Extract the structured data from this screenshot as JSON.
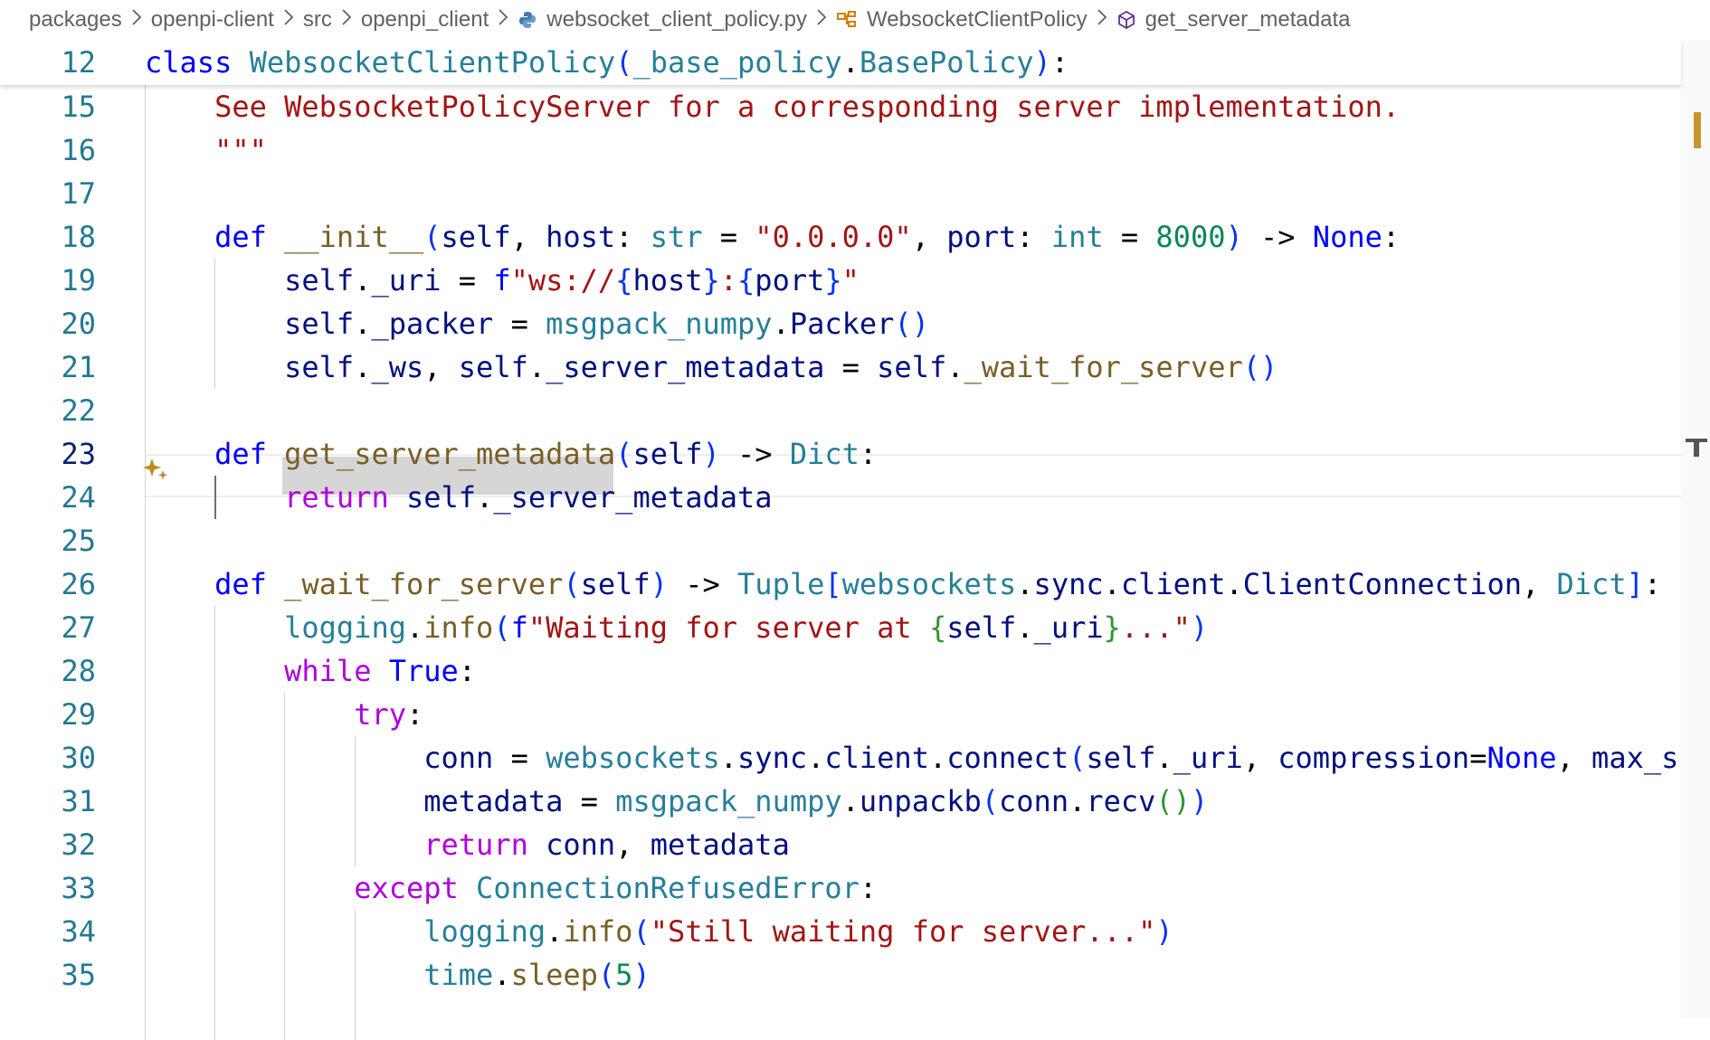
{
  "breadcrumb": [
    {
      "label": "packages",
      "icon": ""
    },
    {
      "label": "openpi-client",
      "icon": ""
    },
    {
      "label": "src",
      "icon": ""
    },
    {
      "label": "openpi_client",
      "icon": ""
    },
    {
      "label": "websocket_client_policy.py",
      "icon": "python-file-icon"
    },
    {
      "label": "WebsocketClientPolicy",
      "icon": "class-symbol-icon"
    },
    {
      "label": "get_server_metadata",
      "icon": "method-symbol-icon"
    }
  ],
  "sticky": {
    "line_number": "12",
    "tokens": [
      {
        "t": "class",
        "c": "kw"
      },
      {
        "t": " ",
        "c": "pl"
      },
      {
        "t": "WebsocketClientPolicy",
        "c": "typ"
      },
      {
        "t": "(",
        "c": "br"
      },
      {
        "t": "_base_policy",
        "c": "typ"
      },
      {
        "t": ".",
        "c": "pl"
      },
      {
        "t": "BasePolicy",
        "c": "typ"
      },
      {
        "t": ")",
        "c": "br"
      },
      {
        "t": ":",
        "c": "pl"
      }
    ]
  },
  "editor": {
    "current_line": "23",
    "highlighted_word": "get_server_metadata",
    "lines": [
      {
        "n": "15",
        "tokens": [
          {
            "t": "    See WebsocketPolicyServer for a corresponding server implementation.",
            "c": "str"
          }
        ]
      },
      {
        "n": "16",
        "tokens": [
          {
            "t": "    \"\"\"",
            "c": "str"
          }
        ]
      },
      {
        "n": "17",
        "tokens": []
      },
      {
        "n": "18",
        "tokens": [
          {
            "t": "    ",
            "c": "pl"
          },
          {
            "t": "def",
            "c": "kw"
          },
          {
            "t": " ",
            "c": "pl"
          },
          {
            "t": "__init__",
            "c": "fn"
          },
          {
            "t": "(",
            "c": "br"
          },
          {
            "t": "self",
            "c": "var"
          },
          {
            "t": ", ",
            "c": "pl"
          },
          {
            "t": "host",
            "c": "var"
          },
          {
            "t": ": ",
            "c": "pl"
          },
          {
            "t": "str",
            "c": "typ"
          },
          {
            "t": " = ",
            "c": "pl"
          },
          {
            "t": "\"0.0.0.0\"",
            "c": "str"
          },
          {
            "t": ", ",
            "c": "pl"
          },
          {
            "t": "port",
            "c": "var"
          },
          {
            "t": ": ",
            "c": "pl"
          },
          {
            "t": "int",
            "c": "typ"
          },
          {
            "t": " = ",
            "c": "pl"
          },
          {
            "t": "8000",
            "c": "num"
          },
          {
            "t": ")",
            "c": "br"
          },
          {
            "t": " -> ",
            "c": "pl"
          },
          {
            "t": "None",
            "c": "kw"
          },
          {
            "t": ":",
            "c": "pl"
          }
        ]
      },
      {
        "n": "19",
        "tokens": [
          {
            "t": "        ",
            "c": "pl"
          },
          {
            "t": "self",
            "c": "var"
          },
          {
            "t": ".",
            "c": "pl"
          },
          {
            "t": "_uri",
            "c": "var"
          },
          {
            "t": " = ",
            "c": "pl"
          },
          {
            "t": "f",
            "c": "kw"
          },
          {
            "t": "\"ws://",
            "c": "str"
          },
          {
            "t": "{",
            "c": "br"
          },
          {
            "t": "host",
            "c": "var"
          },
          {
            "t": "}",
            "c": "br"
          },
          {
            "t": ":",
            "c": "str"
          },
          {
            "t": "{",
            "c": "br"
          },
          {
            "t": "port",
            "c": "var"
          },
          {
            "t": "}",
            "c": "br"
          },
          {
            "t": "\"",
            "c": "str"
          }
        ]
      },
      {
        "n": "20",
        "tokens": [
          {
            "t": "        ",
            "c": "pl"
          },
          {
            "t": "self",
            "c": "var"
          },
          {
            "t": ".",
            "c": "pl"
          },
          {
            "t": "_packer",
            "c": "var"
          },
          {
            "t": " = ",
            "c": "pl"
          },
          {
            "t": "msgpack_numpy",
            "c": "typ"
          },
          {
            "t": ".",
            "c": "pl"
          },
          {
            "t": "Packer",
            "c": "var"
          },
          {
            "t": "()",
            "c": "br"
          }
        ]
      },
      {
        "n": "21",
        "tokens": [
          {
            "t": "        ",
            "c": "pl"
          },
          {
            "t": "self",
            "c": "var"
          },
          {
            "t": ".",
            "c": "pl"
          },
          {
            "t": "_ws",
            "c": "var"
          },
          {
            "t": ", ",
            "c": "pl"
          },
          {
            "t": "self",
            "c": "var"
          },
          {
            "t": ".",
            "c": "pl"
          },
          {
            "t": "_server_metadata",
            "c": "var"
          },
          {
            "t": " = ",
            "c": "pl"
          },
          {
            "t": "self",
            "c": "var"
          },
          {
            "t": ".",
            "c": "pl"
          },
          {
            "t": "_wait_for_server",
            "c": "fn"
          },
          {
            "t": "()",
            "c": "br"
          }
        ]
      },
      {
        "n": "22",
        "tokens": []
      },
      {
        "n": "23",
        "tokens": [
          {
            "t": "    ",
            "c": "pl"
          },
          {
            "t": "def",
            "c": "kw"
          },
          {
            "t": " ",
            "c": "pl"
          },
          {
            "t": "get_server_metadata",
            "c": "fn"
          },
          {
            "t": "(",
            "c": "br"
          },
          {
            "t": "self",
            "c": "var"
          },
          {
            "t": ")",
            "c": "br"
          },
          {
            "t": " -> ",
            "c": "pl"
          },
          {
            "t": "Dict",
            "c": "typ"
          },
          {
            "t": ":",
            "c": "pl"
          }
        ]
      },
      {
        "n": "24",
        "tokens": [
          {
            "t": "        ",
            "c": "pl"
          },
          {
            "t": "return",
            "c": "ctl"
          },
          {
            "t": " ",
            "c": "pl"
          },
          {
            "t": "self",
            "c": "var"
          },
          {
            "t": ".",
            "c": "pl"
          },
          {
            "t": "_server_metadata",
            "c": "var"
          }
        ]
      },
      {
        "n": "25",
        "tokens": []
      },
      {
        "n": "26",
        "tokens": [
          {
            "t": "    ",
            "c": "pl"
          },
          {
            "t": "def",
            "c": "kw"
          },
          {
            "t": " ",
            "c": "pl"
          },
          {
            "t": "_wait_for_server",
            "c": "fn"
          },
          {
            "t": "(",
            "c": "br"
          },
          {
            "t": "self",
            "c": "var"
          },
          {
            "t": ")",
            "c": "br"
          },
          {
            "t": " -> ",
            "c": "pl"
          },
          {
            "t": "Tuple",
            "c": "typ"
          },
          {
            "t": "[",
            "c": "br"
          },
          {
            "t": "websockets",
            "c": "typ"
          },
          {
            "t": ".",
            "c": "pl"
          },
          {
            "t": "sync",
            "c": "var"
          },
          {
            "t": ".",
            "c": "pl"
          },
          {
            "t": "client",
            "c": "var"
          },
          {
            "t": ".",
            "c": "pl"
          },
          {
            "t": "ClientConnection",
            "c": "var"
          },
          {
            "t": ", ",
            "c": "pl"
          },
          {
            "t": "Dict",
            "c": "typ"
          },
          {
            "t": "]",
            "c": "br"
          },
          {
            "t": ":",
            "c": "pl"
          }
        ]
      },
      {
        "n": "27",
        "tokens": [
          {
            "t": "        ",
            "c": "pl"
          },
          {
            "t": "logging",
            "c": "typ"
          },
          {
            "t": ".",
            "c": "pl"
          },
          {
            "t": "info",
            "c": "fn"
          },
          {
            "t": "(",
            "c": "br"
          },
          {
            "t": "f",
            "c": "kw"
          },
          {
            "t": "\"Waiting for server at ",
            "c": "str"
          },
          {
            "t": "{",
            "c": "br2"
          },
          {
            "t": "self",
            "c": "var"
          },
          {
            "t": ".",
            "c": "pl"
          },
          {
            "t": "_uri",
            "c": "var"
          },
          {
            "t": "}",
            "c": "br2"
          },
          {
            "t": "...\"",
            "c": "str"
          },
          {
            "t": ")",
            "c": "br"
          }
        ]
      },
      {
        "n": "28",
        "tokens": [
          {
            "t": "        ",
            "c": "pl"
          },
          {
            "t": "while",
            "c": "ctl"
          },
          {
            "t": " ",
            "c": "pl"
          },
          {
            "t": "True",
            "c": "kw"
          },
          {
            "t": ":",
            "c": "pl"
          }
        ]
      },
      {
        "n": "29",
        "tokens": [
          {
            "t": "            ",
            "c": "pl"
          },
          {
            "t": "try",
            "c": "ctl"
          },
          {
            "t": ":",
            "c": "pl"
          }
        ]
      },
      {
        "n": "30",
        "tokens": [
          {
            "t": "                ",
            "c": "pl"
          },
          {
            "t": "conn",
            "c": "var"
          },
          {
            "t": " = ",
            "c": "pl"
          },
          {
            "t": "websockets",
            "c": "typ"
          },
          {
            "t": ".",
            "c": "pl"
          },
          {
            "t": "sync",
            "c": "var"
          },
          {
            "t": ".",
            "c": "pl"
          },
          {
            "t": "client",
            "c": "var"
          },
          {
            "t": ".",
            "c": "pl"
          },
          {
            "t": "connect",
            "c": "var"
          },
          {
            "t": "(",
            "c": "br"
          },
          {
            "t": "self",
            "c": "var"
          },
          {
            "t": ".",
            "c": "pl"
          },
          {
            "t": "_uri",
            "c": "var"
          },
          {
            "t": ", ",
            "c": "pl"
          },
          {
            "t": "compression",
            "c": "var"
          },
          {
            "t": "=",
            "c": "pl"
          },
          {
            "t": "None",
            "c": "kw"
          },
          {
            "t": ", ",
            "c": "pl"
          },
          {
            "t": "max_siz",
            "c": "var"
          }
        ]
      },
      {
        "n": "31",
        "tokens": [
          {
            "t": "                ",
            "c": "pl"
          },
          {
            "t": "metadata",
            "c": "var"
          },
          {
            "t": " = ",
            "c": "pl"
          },
          {
            "t": "msgpack_numpy",
            "c": "typ"
          },
          {
            "t": ".",
            "c": "pl"
          },
          {
            "t": "unpackb",
            "c": "var"
          },
          {
            "t": "(",
            "c": "br"
          },
          {
            "t": "conn",
            "c": "var"
          },
          {
            "t": ".",
            "c": "pl"
          },
          {
            "t": "recv",
            "c": "var"
          },
          {
            "t": "()",
            "c": "br2"
          },
          {
            "t": ")",
            "c": "br"
          }
        ]
      },
      {
        "n": "32",
        "tokens": [
          {
            "t": "                ",
            "c": "pl"
          },
          {
            "t": "return",
            "c": "ctl"
          },
          {
            "t": " ",
            "c": "pl"
          },
          {
            "t": "conn",
            "c": "var"
          },
          {
            "t": ", ",
            "c": "pl"
          },
          {
            "t": "metadata",
            "c": "var"
          }
        ]
      },
      {
        "n": "33",
        "tokens": [
          {
            "t": "            ",
            "c": "pl"
          },
          {
            "t": "except",
            "c": "ctl"
          },
          {
            "t": " ",
            "c": "pl"
          },
          {
            "t": "ConnectionRefusedError",
            "c": "typ"
          },
          {
            "t": ":",
            "c": "pl"
          }
        ]
      },
      {
        "n": "34",
        "tokens": [
          {
            "t": "                ",
            "c": "pl"
          },
          {
            "t": "logging",
            "c": "typ"
          },
          {
            "t": ".",
            "c": "pl"
          },
          {
            "t": "info",
            "c": "fn"
          },
          {
            "t": "(",
            "c": "br"
          },
          {
            "t": "\"Still waiting for server...\"",
            "c": "str"
          },
          {
            "t": ")",
            "c": "br"
          }
        ]
      },
      {
        "n": "35",
        "tokens": [
          {
            "t": "                ",
            "c": "pl"
          },
          {
            "t": "time",
            "c": "typ"
          },
          {
            "t": ".",
            "c": "pl"
          },
          {
            "t": "sleep",
            "c": "fn"
          },
          {
            "t": "(",
            "c": "br"
          },
          {
            "t": "5",
            "c": "num"
          },
          {
            "t": ")",
            "c": "br"
          }
        ]
      }
    ]
  },
  "colors": {
    "keyword": "#0000ff",
    "control": "#af00db",
    "string": "#a31515",
    "number": "#098658",
    "type": "#267f99",
    "function": "#795e26",
    "variable": "#001080",
    "line_number": "#237893",
    "overview_ruler_mark": "#c8962d"
  }
}
